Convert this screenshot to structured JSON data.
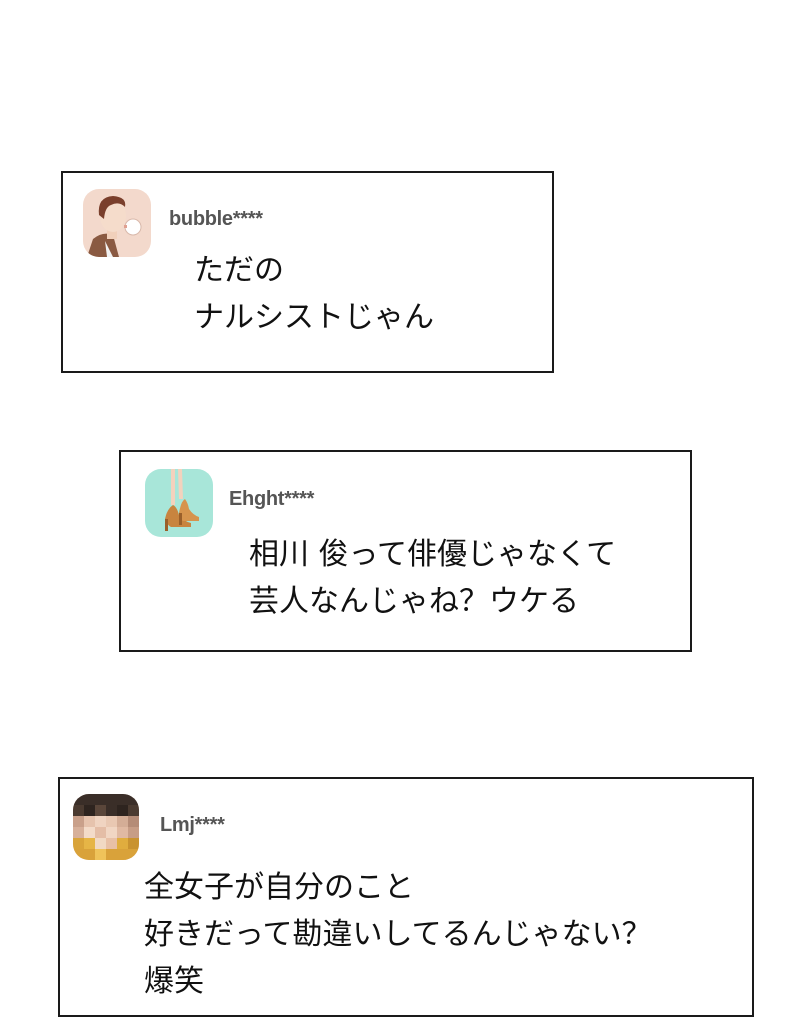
{
  "comments": [
    {
      "username": "bubble****",
      "lines": [
        "ただの",
        "ナルシストじゃん"
      ],
      "avatar": "man-blowing-bubblegum-avatar"
    },
    {
      "username": "Ehght****",
      "lines": [
        "相川 俊って俳優じゃなくて",
        "芸人なんじゃね？ウケる"
      ],
      "avatar": "high-heel-feet-avatar"
    },
    {
      "username": "Lmj****",
      "lines": [
        "全女子が自分のこと",
        "好きだって勘違いしてるんじゃない？",
        "爆笑"
      ],
      "avatar": "pixelated-face-avatar"
    }
  ],
  "colors": {
    "border": "#1a1a1a",
    "username": "#555555",
    "text": "#111111",
    "avatar1_bg": "#f3d9cc",
    "avatar2_bg": "#a8e6d9",
    "avatar3_bg": "#e8c9b5"
  }
}
